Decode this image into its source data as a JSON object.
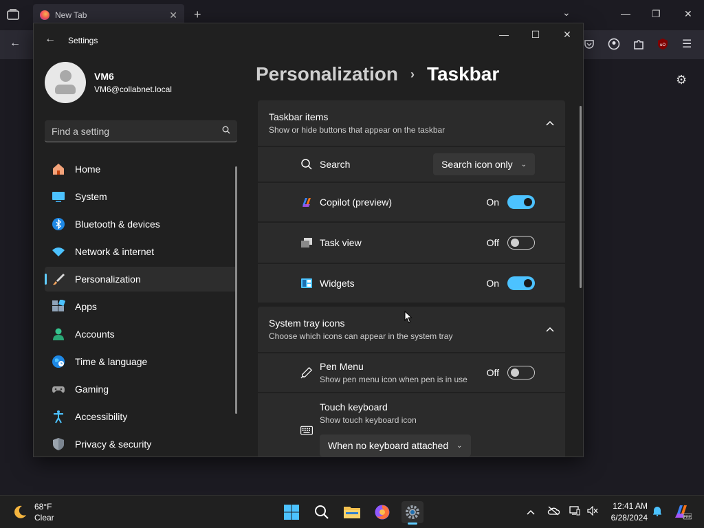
{
  "browser": {
    "tab_title": "New Tab",
    "tab_close": "✕",
    "new_tab": "+",
    "list_tabs": "⌄",
    "minimize": "—",
    "restore": "❐",
    "close": "✕",
    "back": "←"
  },
  "settings": {
    "app_title": "Settings",
    "window_controls": {
      "minimize": "—",
      "maximize": "☐",
      "close": "✕"
    },
    "profile": {
      "name": "VM6",
      "email": "VM6@collabnet.local"
    },
    "search": {
      "placeholder": "Find a setting"
    },
    "nav": [
      {
        "label": "Home",
        "icon": "home-icon"
      },
      {
        "label": "System",
        "icon": "system-icon"
      },
      {
        "label": "Bluetooth & devices",
        "icon": "bluetooth-icon"
      },
      {
        "label": "Network & internet",
        "icon": "wifi-icon"
      },
      {
        "label": "Personalization",
        "icon": "brush-icon",
        "active": true
      },
      {
        "label": "Apps",
        "icon": "apps-icon"
      },
      {
        "label": "Accounts",
        "icon": "accounts-icon"
      },
      {
        "label": "Time & language",
        "icon": "globe-icon"
      },
      {
        "label": "Gaming",
        "icon": "gamepad-icon"
      },
      {
        "label": "Accessibility",
        "icon": "accessibility-icon"
      },
      {
        "label": "Privacy & security",
        "icon": "shield-icon"
      }
    ],
    "breadcrumb": {
      "parent": "Personalization",
      "separator": "›",
      "current": "Taskbar"
    },
    "taskbar_items": {
      "title": "Taskbar items",
      "subtitle": "Show or hide buttons that appear on the taskbar",
      "search": {
        "label": "Search",
        "value": "Search icon only"
      },
      "copilot": {
        "label": "Copilot (preview)",
        "state": "On"
      },
      "task_view": {
        "label": "Task view",
        "state": "Off"
      },
      "widgets": {
        "label": "Widgets",
        "state": "On"
      }
    },
    "system_tray": {
      "title": "System tray icons",
      "subtitle": "Choose which icons can appear in the system tray",
      "pen_menu": {
        "label": "Pen Menu",
        "description": "Show pen menu icon when pen is in use",
        "state": "Off"
      },
      "touch_keyboard": {
        "label": "Touch keyboard",
        "description": "Show touch keyboard icon",
        "value": "When no keyboard attached"
      }
    }
  },
  "taskbar": {
    "weather": {
      "temp": "68°F",
      "condition": "Clear"
    },
    "clock": {
      "time": "12:41 AM",
      "date": "6/28/2024"
    }
  },
  "colors": {
    "accent": "#4cc2ff",
    "window_bg": "#202020",
    "card_bg": "#2b2b2b"
  }
}
